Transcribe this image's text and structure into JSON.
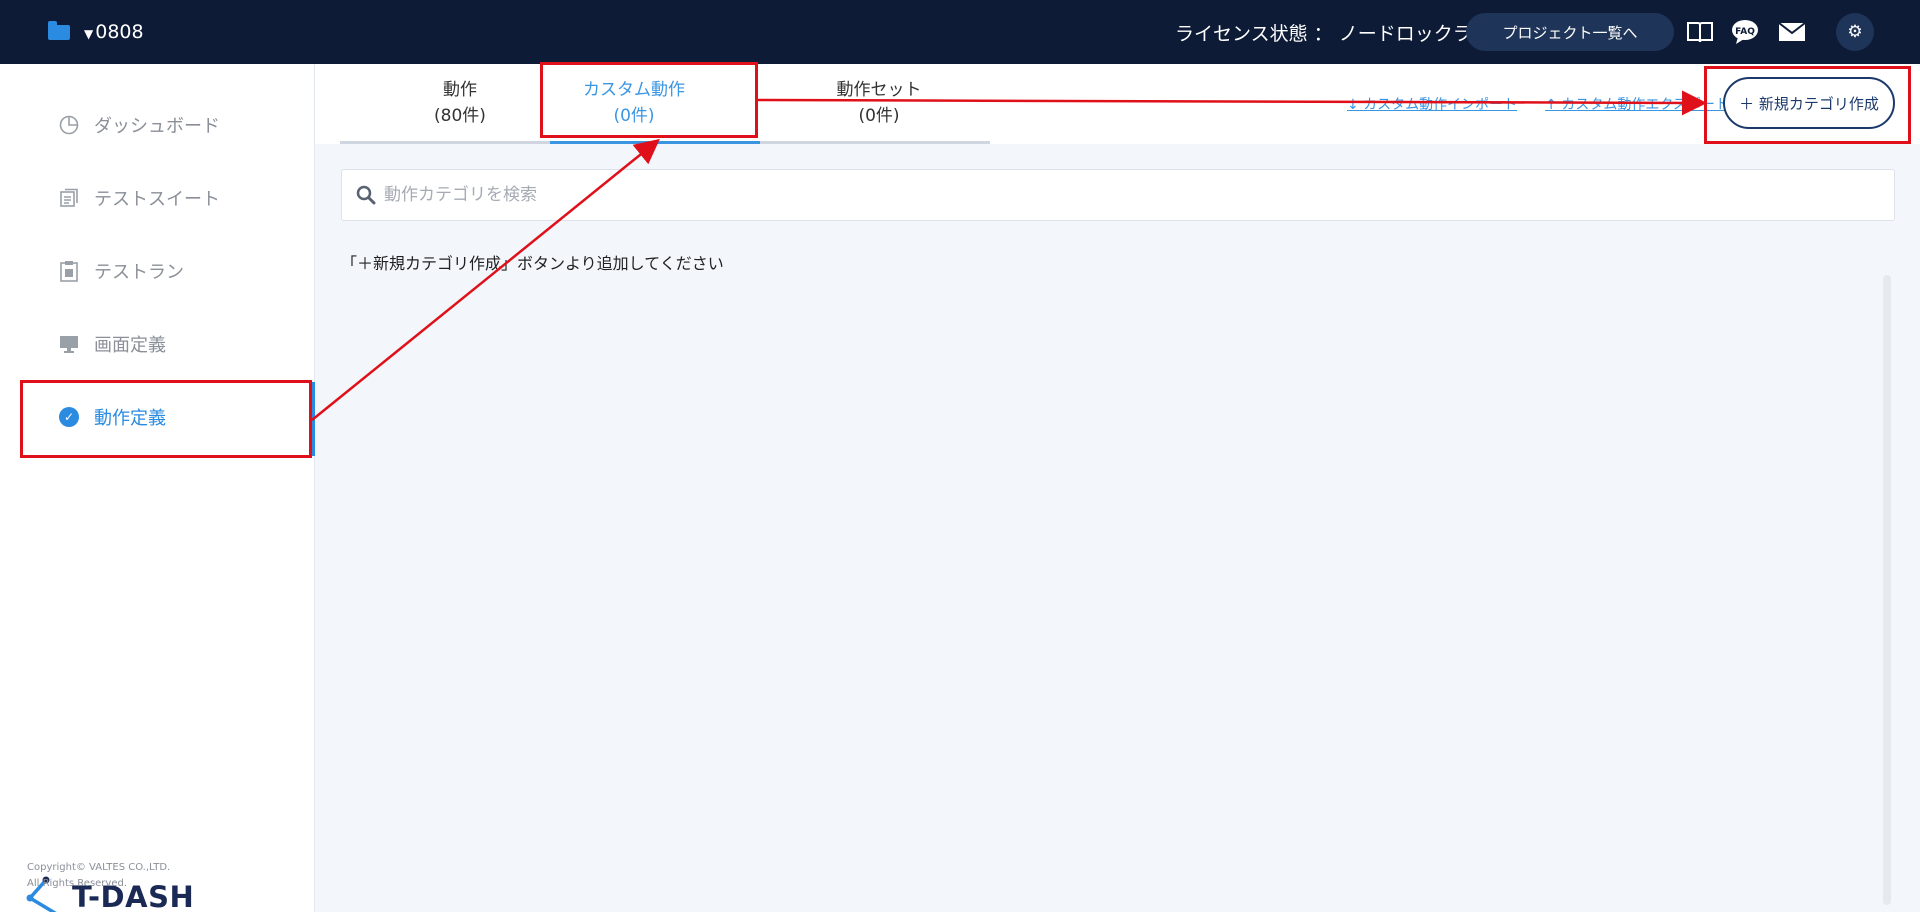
{
  "topbar": {
    "project_name": "0808",
    "license_text": "ライセンス状態 ： ノードロックライセンス",
    "project_list_button": "プロジェクト一覧へ",
    "faq_label": "FAQ"
  },
  "sidebar": {
    "items": [
      {
        "label": "ダッシュボード"
      },
      {
        "label": "テストスイート"
      },
      {
        "label": "テストラン"
      },
      {
        "label": "画面定義"
      },
      {
        "label": "動作定義"
      }
    ],
    "logo_text": "T-DASH",
    "copyright_line1": "Copyright© VALTES CO.,LTD.",
    "copyright_line2": "All Rights Reserved."
  },
  "tabs": [
    {
      "label": "動作",
      "count": "(80件)"
    },
    {
      "label": "カスタム動作",
      "count": "(0件)"
    },
    {
      "label": "動作セット",
      "count": "(0件)"
    }
  ],
  "links": {
    "import": "↓ カスタム動作インポート",
    "export": "↑ カスタム動作エクスポート"
  },
  "new_category_button": "＋ 新規カテゴリ作成",
  "search": {
    "placeholder": "動作カテゴリを検索"
  },
  "hint_text": "「＋新規カテゴリ作成」ボタンより追加してください",
  "colors": {
    "topbar": "#0d1b36",
    "accent": "#2a8be0",
    "annotation": "#e0101a"
  }
}
